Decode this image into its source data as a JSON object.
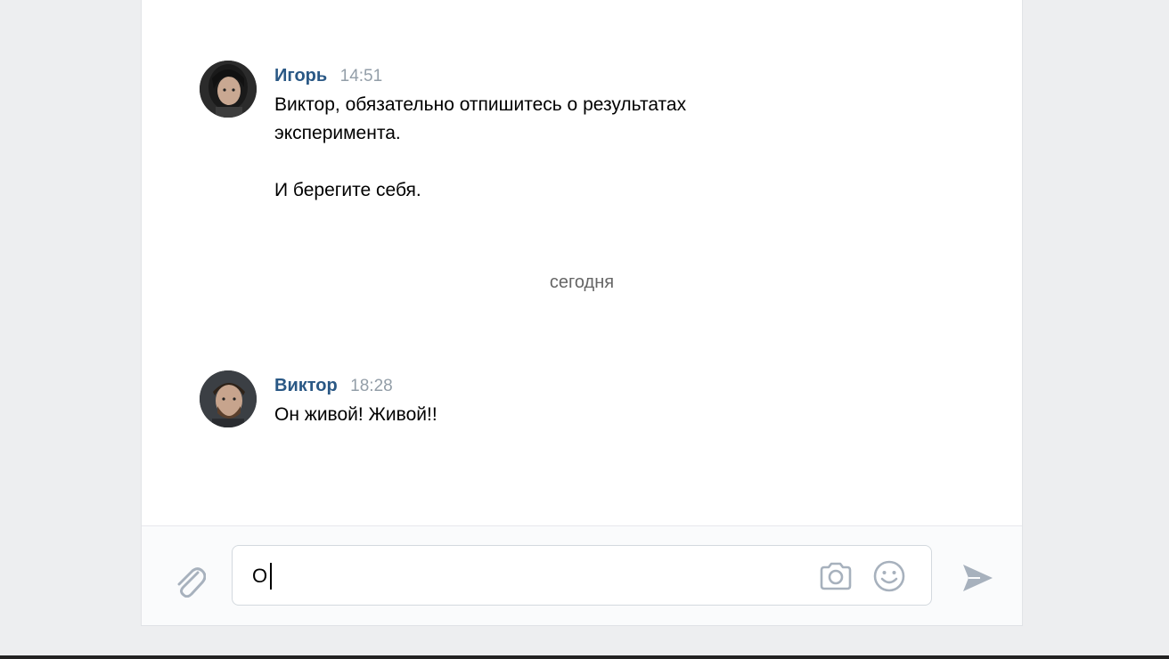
{
  "messages": [
    {
      "author": "Игорь",
      "time": "14:51",
      "text": "Виктор, обязательно отпишитесь о результатах\nэксперимента.\n\nИ берегите себя.",
      "avatar_icon": "user-avatar-igor"
    },
    {
      "author": "Виктор",
      "time": "18:28",
      "text": "Он живой! Живой!!",
      "avatar_icon": "user-avatar-viktor"
    }
  ],
  "date_divider": "сегодня",
  "composer": {
    "input_value": "О",
    "attach_icon": "paperclip-icon",
    "camera_icon": "camera-icon",
    "emoji_icon": "smiley-icon",
    "send_icon": "send-arrow-icon"
  },
  "colors": {
    "author": "#2a5885",
    "time": "#939ea8",
    "icon": "#a7b1bd",
    "background": "#edeef0"
  }
}
